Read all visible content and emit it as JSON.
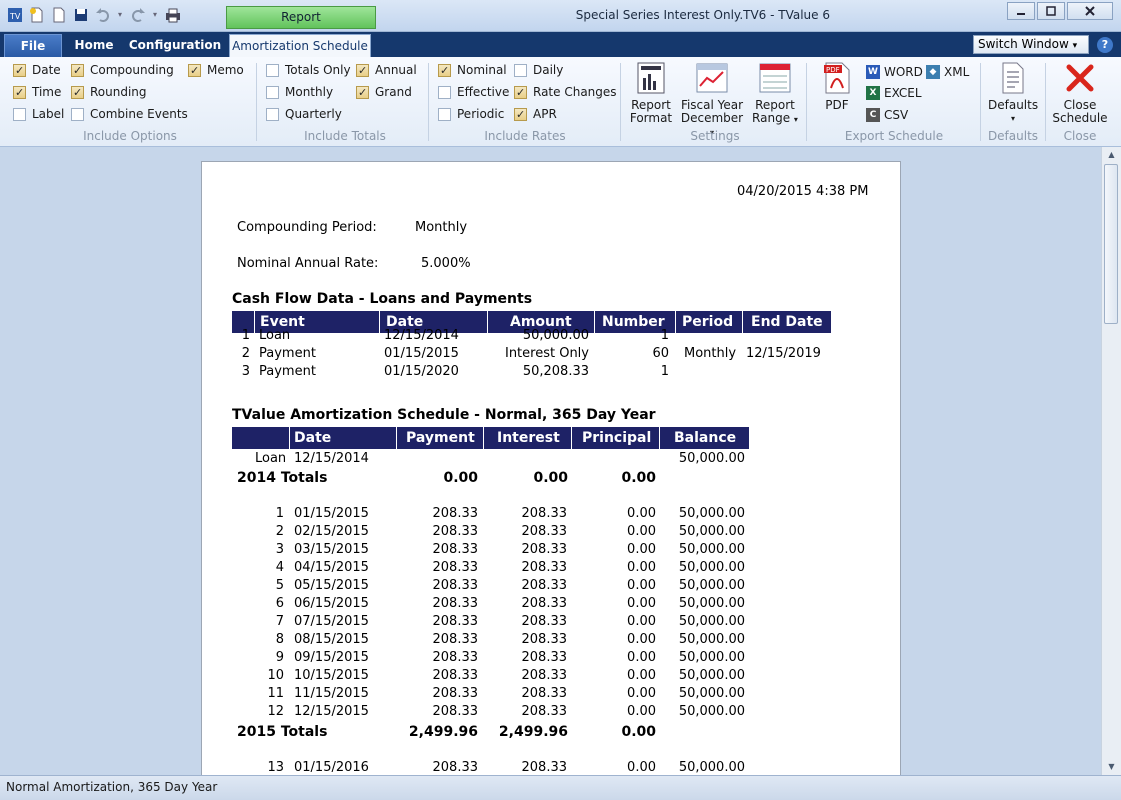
{
  "window": {
    "context_tab": "Report",
    "title": "Special Series Interest Only.TV6 - TValue 6"
  },
  "ribbon_tabs": {
    "file": "File",
    "home": "Home",
    "configuration": "Configuration",
    "amortization_schedule": "Amortization Schedule"
  },
  "switch_window": "Switch Window",
  "help": "?",
  "include_options": {
    "date": "Date",
    "time": "Time",
    "label": "Label",
    "compounding": "Compounding",
    "rounding": "Rounding",
    "combine_events": "Combine Events",
    "memo": "Memo",
    "group": "Include Options"
  },
  "include_totals": {
    "totals_only": "Totals Only",
    "monthly": "Monthly",
    "quarterly": "Quarterly",
    "annual": "Annual",
    "grand": "Grand",
    "group": "Include Totals"
  },
  "include_rates": {
    "nominal": "Nominal",
    "effective": "Effective",
    "periodic": "Periodic",
    "daily": "Daily",
    "rate_changes": "Rate Changes",
    "apr": "APR",
    "group": "Include Rates"
  },
  "settings": {
    "report_format_1": "Report",
    "report_format_2": "Format",
    "fiscal_year_1": "Fiscal Year",
    "fiscal_year_2": "December",
    "report_range_1": "Report",
    "report_range_2": "Range",
    "group": "Settings"
  },
  "export": {
    "pdf": "PDF",
    "word": "WORD",
    "excel": "EXCEL",
    "csv": "CSV",
    "xml": "XML",
    "group": "Export Schedule"
  },
  "defaults": {
    "label": "Defaults",
    "group": "Defaults"
  },
  "close": {
    "label_1": "Close",
    "label_2": "Schedule",
    "group": "Close"
  },
  "report": {
    "datetime": "04/20/2015   4:38 PM",
    "compounding_label": "Compounding Period:",
    "compounding_value": "Monthly",
    "rate_label": "Nominal Annual Rate:",
    "rate_value": "5.000%",
    "cashflow_title": "Cash Flow Data - Loans and Payments",
    "cashflow_headers": {
      "event": "Event",
      "date": "Date",
      "amount": "Amount",
      "number": "Number",
      "period": "Period",
      "end_date": "End Date"
    },
    "cashflow_rows": [
      {
        "n": "1",
        "event": "Loan",
        "date": "12/15/2014",
        "amount": "50,000.00",
        "number": "1",
        "period": "",
        "end_date": ""
      },
      {
        "n": "2",
        "event": "Payment",
        "date": "01/15/2015",
        "amount": "Interest Only",
        "number": "60",
        "period": "Monthly",
        "end_date": "12/15/2019"
      },
      {
        "n": "3",
        "event": "Payment",
        "date": "01/15/2020",
        "amount": "50,208.33",
        "number": "1",
        "period": "",
        "end_date": ""
      }
    ],
    "amort_title": "TValue Amortization Schedule - Normal, 365 Day Year",
    "amort_headers": {
      "date": "Date",
      "payment": "Payment",
      "interest": "Interest",
      "principal": "Principal",
      "balance": "Balance"
    },
    "loan_row": {
      "label": "Loan",
      "date": "12/15/2014",
      "balance": "50,000.00"
    },
    "totals_2014": {
      "label": "2014 Totals",
      "payment": "0.00",
      "interest": "0.00",
      "principal": "0.00"
    },
    "rows_2015": [
      {
        "n": "1",
        "date": "01/15/2015",
        "payment": "208.33",
        "interest": "208.33",
        "principal": "0.00",
        "balance": "50,000.00"
      },
      {
        "n": "2",
        "date": "02/15/2015",
        "payment": "208.33",
        "interest": "208.33",
        "principal": "0.00",
        "balance": "50,000.00"
      },
      {
        "n": "3",
        "date": "03/15/2015",
        "payment": "208.33",
        "interest": "208.33",
        "principal": "0.00",
        "balance": "50,000.00"
      },
      {
        "n": "4",
        "date": "04/15/2015",
        "payment": "208.33",
        "interest": "208.33",
        "principal": "0.00",
        "balance": "50,000.00"
      },
      {
        "n": "5",
        "date": "05/15/2015",
        "payment": "208.33",
        "interest": "208.33",
        "principal": "0.00",
        "balance": "50,000.00"
      },
      {
        "n": "6",
        "date": "06/15/2015",
        "payment": "208.33",
        "interest": "208.33",
        "principal": "0.00",
        "balance": "50,000.00"
      },
      {
        "n": "7",
        "date": "07/15/2015",
        "payment": "208.33",
        "interest": "208.33",
        "principal": "0.00",
        "balance": "50,000.00"
      },
      {
        "n": "8",
        "date": "08/15/2015",
        "payment": "208.33",
        "interest": "208.33",
        "principal": "0.00",
        "balance": "50,000.00"
      },
      {
        "n": "9",
        "date": "09/15/2015",
        "payment": "208.33",
        "interest": "208.33",
        "principal": "0.00",
        "balance": "50,000.00"
      },
      {
        "n": "10",
        "date": "10/15/2015",
        "payment": "208.33",
        "interest": "208.33",
        "principal": "0.00",
        "balance": "50,000.00"
      },
      {
        "n": "11",
        "date": "11/15/2015",
        "payment": "208.33",
        "interest": "208.33",
        "principal": "0.00",
        "balance": "50,000.00"
      },
      {
        "n": "12",
        "date": "12/15/2015",
        "payment": "208.33",
        "interest": "208.33",
        "principal": "0.00",
        "balance": "50,000.00"
      }
    ],
    "totals_2015": {
      "label": "2015 Totals",
      "payment": "2,499.96",
      "interest": "2,499.96",
      "principal": "0.00"
    },
    "row_13": {
      "n": "13",
      "date": "01/15/2016",
      "payment": "208.33",
      "interest": "208.33",
      "principal": "0.00",
      "balance": "50,000.00"
    }
  },
  "status": "Normal Amortization, 365 Day Year"
}
